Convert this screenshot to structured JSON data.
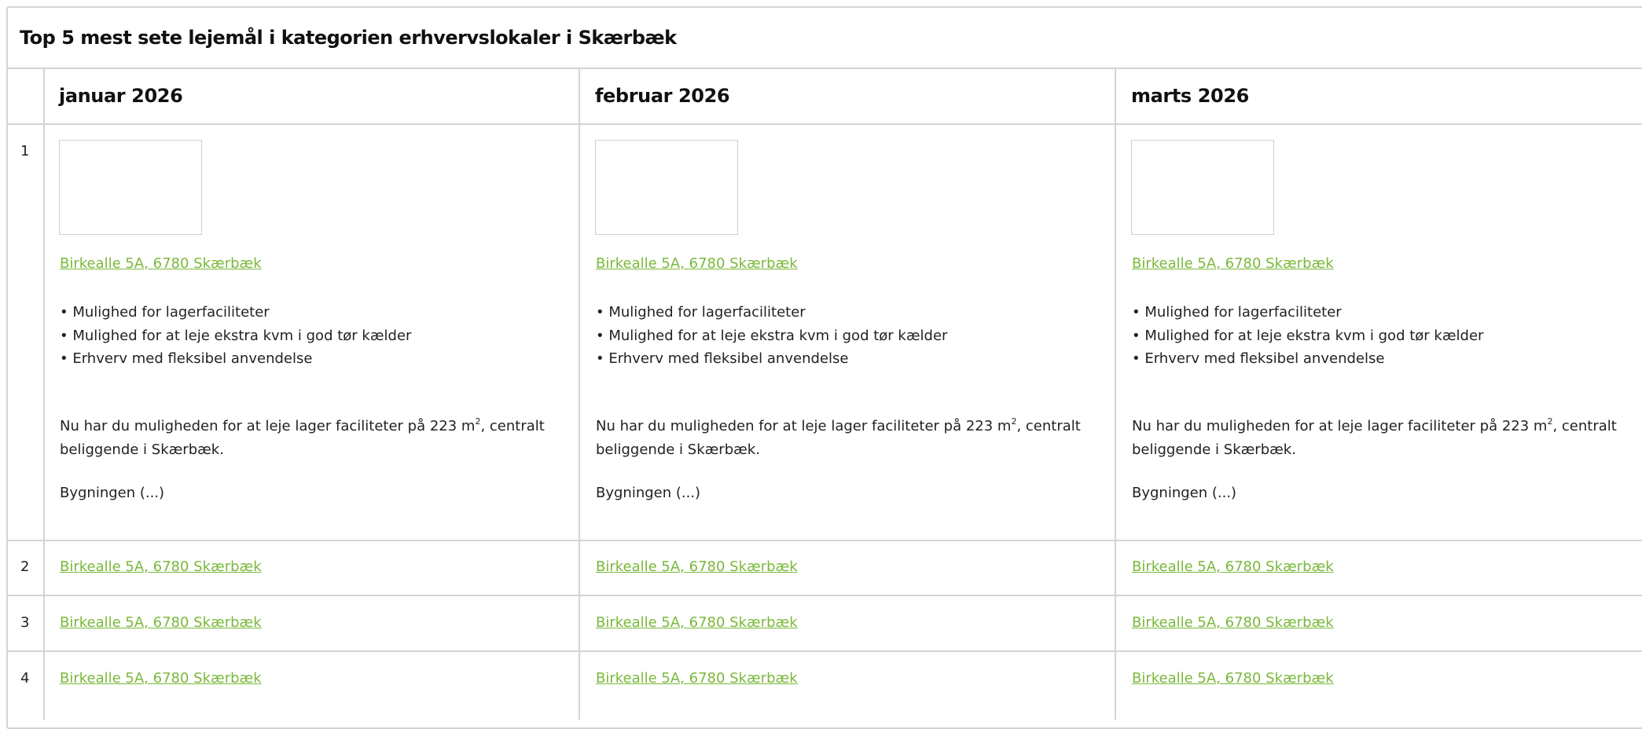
{
  "table": {
    "title": "Top 5 mest sete lejemål i kategorien erhvervslokaler i Skærbæk",
    "columns": [
      "januar 2026",
      "februar 2026",
      "marts 2026"
    ],
    "ranks": [
      "1",
      "2",
      "3",
      "4"
    ],
    "featured": {
      "address": "Birkealle 5A, 6780 Skærbæk",
      "bullets": [
        "Mulighed for lagerfaciliteter",
        "Mulighed for at leje ekstra kvm i god tør kælder",
        "Erhverv med fleksibel anvendelse"
      ],
      "description_before": "Nu har du muligheden for at leje lager faciliteter på 223 m",
      "description_sup": "2",
      "description_after": ", centralt beliggende i Skærbæk.",
      "more": "Bygningen (...)"
    },
    "rows": {
      "r2": [
        "Birkealle 5A, 6780 Skærbæk",
        "Birkealle 5A, 6780 Skærbæk",
        "Birkealle 5A, 6780 Skærbæk"
      ],
      "r3": [
        "Birkealle 5A, 6780 Skærbæk",
        "Birkealle 5A, 6780 Skærbæk",
        "Birkealle 5A, 6780 Skærbæk"
      ],
      "r4": [
        "Birkealle 5A, 6780 Skærbæk",
        "Birkealle 5A, 6780 Skærbæk",
        "Birkealle 5A, 6780 Skærbæk"
      ]
    }
  },
  "colors": {
    "link": "#7ab83a",
    "border": "#d4d4d4"
  }
}
